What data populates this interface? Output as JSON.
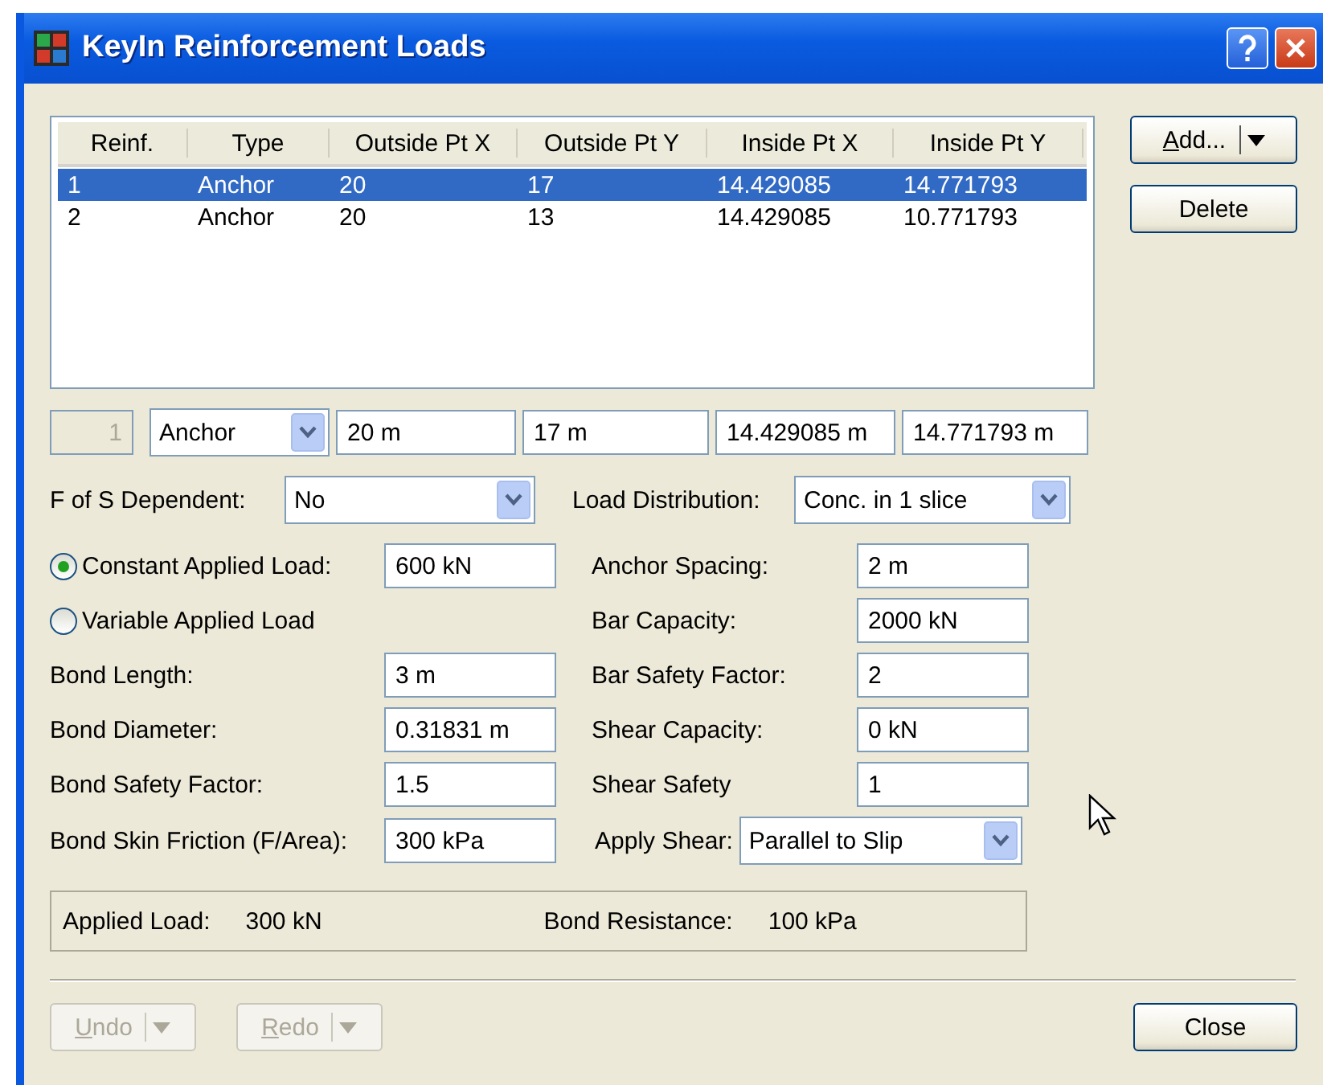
{
  "window": {
    "title": "KeyIn Reinforcement Loads"
  },
  "table": {
    "columns": [
      "Reinf.",
      "Type",
      "Outside Pt X",
      "Outside Pt Y",
      "Inside Pt X",
      "Inside Pt Y"
    ],
    "rows": [
      {
        "cells": [
          "1",
          "Anchor",
          "20",
          "17",
          "14.429085",
          "14.771793"
        ],
        "selected": true
      },
      {
        "cells": [
          "2",
          "Anchor",
          "20",
          "13",
          "14.429085",
          "10.771793"
        ],
        "selected": false
      }
    ]
  },
  "side_buttons": [
    {
      "label": "Add...",
      "kind": "split"
    },
    {
      "label": "Delete",
      "kind": "plain"
    }
  ],
  "edit_row": {
    "index": {
      "value": "1",
      "disabled": true
    },
    "type": "Anchor",
    "fields": [
      "20 m",
      "17 m",
      "14.429085 m",
      "14.771793 m"
    ]
  },
  "fos_dependent": {
    "label": "F of S Dependent:",
    "value": "No"
  },
  "load_distribution": {
    "label": "Load Distribution:",
    "value": "Conc. in 1 slice"
  },
  "left_rows": [
    {
      "kind": "radio",
      "label": "Constant Applied Load:",
      "selected": true,
      "value": "600 kN"
    },
    {
      "kind": "radio",
      "label": "Variable Applied Load",
      "selected": false
    },
    {
      "kind": "field",
      "label": "Bond Length:",
      "value": "3 m"
    },
    {
      "kind": "field",
      "label": "Bond Diameter:",
      "value": "0.31831 m"
    },
    {
      "kind": "field",
      "label": "Bond Safety Factor:",
      "value": "1.5"
    },
    {
      "kind": "field",
      "label": "Bond Skin Friction (F/Area):",
      "value": "300 kPa"
    }
  ],
  "right_rows": [
    {
      "kind": "field",
      "label": "Anchor Spacing:",
      "value": "2 m"
    },
    {
      "kind": "field",
      "label": "Bar Capacity:",
      "value": "2000 kN"
    },
    {
      "kind": "field",
      "label": "Bar Safety Factor:",
      "value": "2"
    },
    {
      "kind": "field",
      "label": "Shear Capacity:",
      "value": "0 kN"
    },
    {
      "kind": "field",
      "label": "Shear Safety",
      "value": "1"
    },
    {
      "kind": "select",
      "label": "Apply Shear:",
      "value": "Parallel to Slip"
    }
  ],
  "summary": [
    {
      "label": "Applied Load:",
      "value": "300 kN"
    },
    {
      "label": "Bond Resistance:",
      "value": "100 kPa"
    }
  ],
  "footer_buttons": [
    {
      "label": "Undo",
      "kind": "split",
      "disabled": true
    },
    {
      "label": "Redo",
      "kind": "split",
      "disabled": true
    },
    {
      "label": "Close",
      "kind": "plain",
      "disabled": false
    }
  ]
}
